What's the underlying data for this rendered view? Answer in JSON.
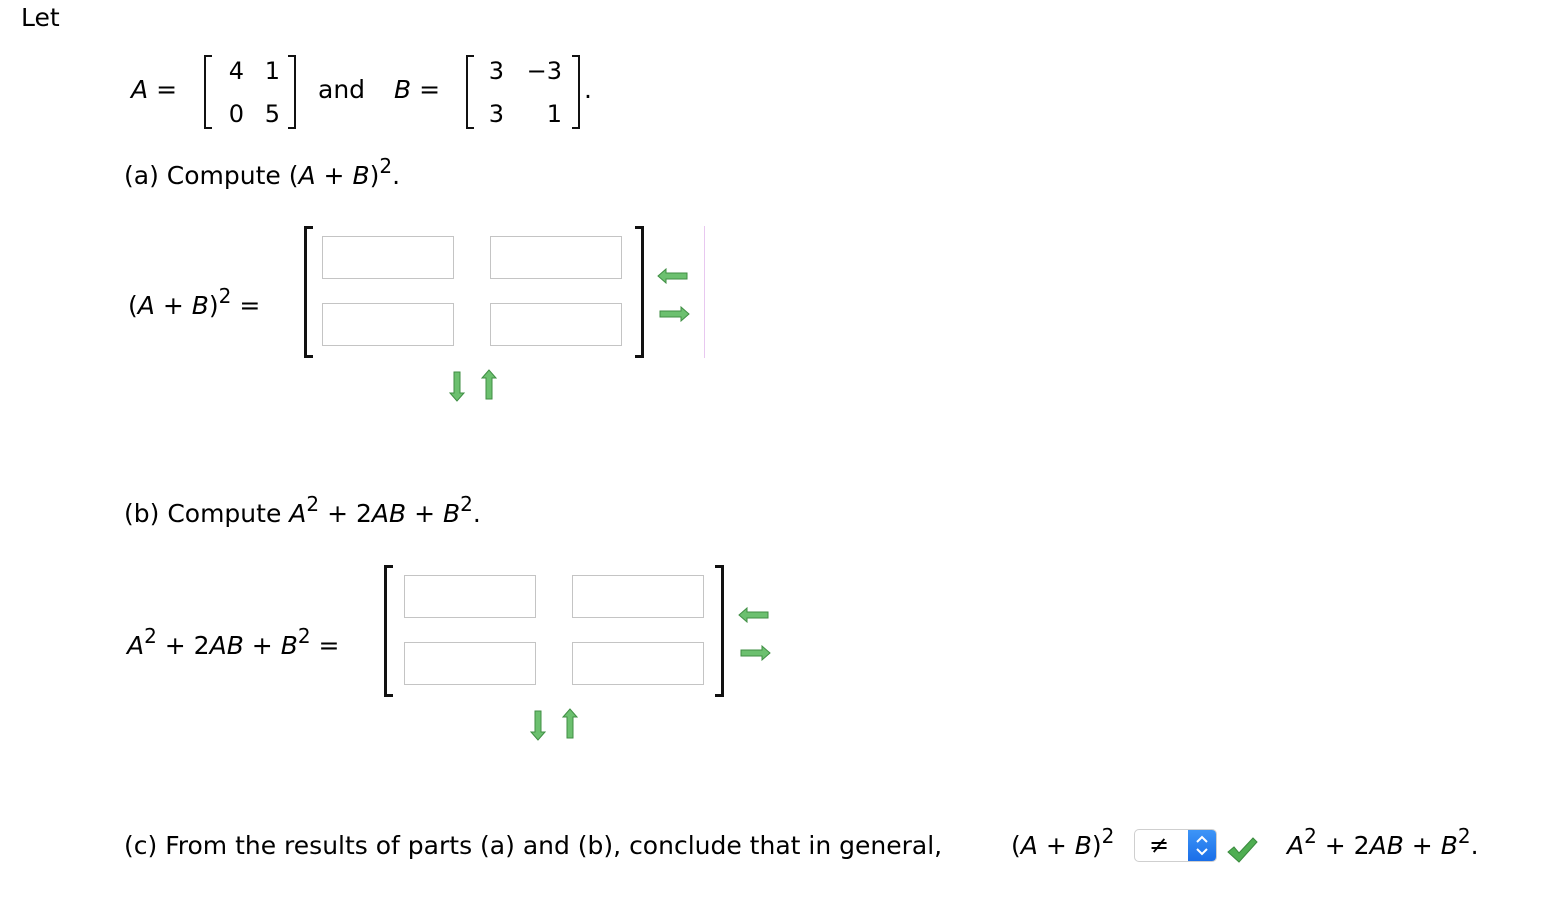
{
  "intro": "Let",
  "given": {
    "a_label": "A",
    "eq": "=",
    "and": "and",
    "b_label": "B",
    "period": ".",
    "A": [
      [
        "4",
        "1"
      ],
      [
        "0",
        "5"
      ]
    ],
    "B": [
      [
        "3",
        "−3"
      ],
      [
        "3",
        "1"
      ]
    ]
  },
  "part_a": {
    "prefix": "(a) Compute (",
    "A": "A",
    "plus": " + ",
    "B": "B",
    "close": ")",
    "exp": "2",
    "end": ".",
    "lhs_open": "(",
    "lhs_close": ")",
    "lhs_eq": " =",
    "inputs": [
      [
        "",
        ""
      ],
      [
        "",
        ""
      ]
    ]
  },
  "part_b": {
    "prefix": "(b) Compute ",
    "A": "A",
    "exp": "2",
    "mid1": " + 2",
    "AB": "AB",
    "mid2": " + ",
    "B": "B",
    "end": ".",
    "lhs_eq": " =",
    "inputs": [
      [
        "",
        ""
      ],
      [
        "",
        ""
      ]
    ]
  },
  "part_c": {
    "text": "(c) From the results of parts (a) and (b), conclude that in general, ",
    "lhs_open": "(",
    "A": "A",
    "plus": " + ",
    "B": "B",
    "lhs_close": ")",
    "exp": "2",
    "select_value": "≠",
    "status": "correct",
    "rhs_A": "A",
    "rhs_mid": " + 2",
    "rhs_AB": "AB",
    "rhs_plus": " + ",
    "rhs_B": "B",
    "rhs_end": "."
  },
  "colors": {
    "arrow_green": "#4caf50",
    "check_green": "#3fa34d",
    "select_blue": "#2a7ff0",
    "input_border": "#c4c4c4"
  }
}
